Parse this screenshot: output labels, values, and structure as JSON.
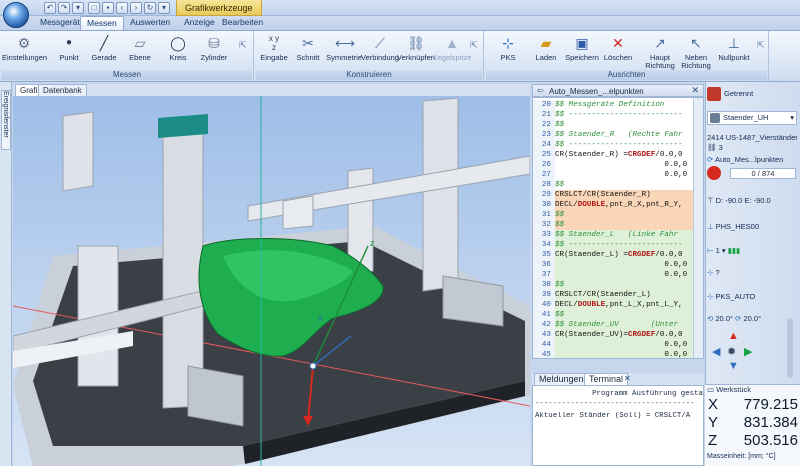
{
  "titlebar": {
    "contextual_tab": "Grafikwerkzeuge"
  },
  "tabs": [
    "Messgerät",
    "Messen",
    "Auswerten",
    "Anzeige",
    "Bearbeiten"
  ],
  "ribbon": {
    "groups": [
      "Messen",
      "Konstruieren",
      "Ausrichten"
    ],
    "messen_buttons": [
      "Einstellungen",
      "Punkt",
      "Gerade",
      "Ebene",
      "Kreis",
      "Zylinder"
    ],
    "konstruieren_buttons": [
      "Eingabe",
      "Schnitt",
      "Symmetrie",
      "Verbindung",
      "Verknüpfen",
      "Kegelspitze"
    ],
    "ausrichten_buttons": [
      "PKS",
      "Laden",
      "Speichern",
      "Löschen",
      "Haupt Richtung",
      "Neben Richtung",
      "Nullpunkt"
    ]
  },
  "side_label": "Ereignisfenster",
  "view_tabs": [
    "Grafik",
    "Datenbank"
  ],
  "editor": {
    "title": "Auto_Messen_...elpunkten",
    "lines": [
      {
        "n": "20",
        "t": "$$ Messgeräte Definition",
        "k": "com",
        "bg": ""
      },
      {
        "n": "21",
        "t": "$$ -------------------------",
        "k": "com",
        "bg": ""
      },
      {
        "n": "22",
        "t": "$$",
        "k": "com",
        "bg": ""
      },
      {
        "n": "23",
        "t": "$$ Staender_R   (Rechte Fahr",
        "k": "com",
        "bg": ""
      },
      {
        "n": "24",
        "t": "$$ -------------------------",
        "k": "com",
        "bg": ""
      },
      {
        "n": "25",
        "t": "CR(Staender_R) =CRGDEF/0.0,0",
        "k": "code",
        "bg": ""
      },
      {
        "n": "26",
        "t": "                        0.0,0",
        "k": "code",
        "bg": ""
      },
      {
        "n": "27",
        "t": "                        0.0,0",
        "k": "code",
        "bg": ""
      },
      {
        "n": "28",
        "t": "$$",
        "k": "com",
        "bg": ""
      },
      {
        "n": "29",
        "t": "CRSLCT/CR(Staender_R)",
        "k": "code",
        "bg": "o"
      },
      {
        "n": "30",
        "t": "DECL/DOUBLE,pnt_R_X,pnt_R_Y,",
        "k": "code",
        "bg": "o"
      },
      {
        "n": "31",
        "t": "$$",
        "k": "com",
        "bg": "o"
      },
      {
        "n": "32",
        "t": "$$",
        "k": "com",
        "bg": "o"
      },
      {
        "n": "33",
        "t": "$$ Staender_L   (Linke Fahr",
        "k": "com",
        "bg": "g"
      },
      {
        "n": "34",
        "t": "$$ -------------------------",
        "k": "com",
        "bg": "g"
      },
      {
        "n": "35",
        "t": "CR(Staender_L) =CRGDEF/0.0,0",
        "k": "code",
        "bg": "g"
      },
      {
        "n": "36",
        "t": "                        0.0,0",
        "k": "code",
        "bg": "g"
      },
      {
        "n": "37",
        "t": "                        0.0,0",
        "k": "code",
        "bg": "g"
      },
      {
        "n": "38",
        "t": "$$",
        "k": "com",
        "bg": "g"
      },
      {
        "n": "39",
        "t": "CRSLCT/CR(Staender_L)",
        "k": "code",
        "bg": "g"
      },
      {
        "n": "40",
        "t": "DECL/DOUBLE,pnt_L_X,pnt_L_Y,",
        "k": "code",
        "bg": "g"
      },
      {
        "n": "41",
        "t": "$$",
        "k": "com",
        "bg": "g"
      },
      {
        "n": "42",
        "t": "$$ Staender_UV       (Unter",
        "k": "com",
        "bg": "g"
      },
      {
        "n": "43",
        "t": "CR(Staender_UV)=CRGDEF/0.0,0",
        "k": "code",
        "bg": "g"
      },
      {
        "n": "44",
        "t": "                        0.0,0",
        "k": "code",
        "bg": "g"
      },
      {
        "n": "45",
        "t": "                        0.0,0",
        "k": "code",
        "bg": "g"
      }
    ]
  },
  "messages": {
    "tabs": [
      "Meldungen",
      "Terminal"
    ],
    "line1": "Programm Ausführung gesta",
    "line2": "Aktueller Ständer (Soll) = CRSLCT/A",
    "separator": "------------------------------------"
  },
  "right_panel": {
    "mode": "Getrennt",
    "staender": "Staender_UH",
    "program": "2414 US-1487_Vierständer...",
    "count": "3",
    "auto_name": "Auto_Mes...lpunkten",
    "progress": "0 / 874",
    "probe_angles": "D: -90.0  E: -90.0",
    "probe_name": "PHS_HES00",
    "probe_value": "1",
    "pks_question": "?",
    "pks_name": "PKS_AUTO",
    "angle1": "20.0°",
    "angle2": "20.0°",
    "workpiece_label": "Werkstück",
    "x": "779.215",
    "y": "831.384",
    "z": "503.516",
    "unit_label": "Masseinheit: [mm; °C]"
  },
  "colors": {
    "accent": "#2f6fc0",
    "probe_red": "#d62a1e",
    "part_green": "#18b64a"
  }
}
